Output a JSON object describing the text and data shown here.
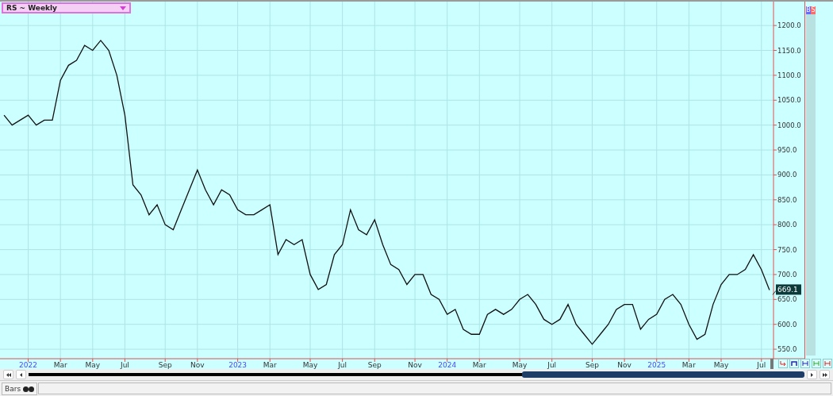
{
  "side_buttons": [
    {
      "label": "B",
      "color": "#6a6aff"
    },
    {
      "label": "S",
      "color": "#ff6a6a"
    }
  ],
  "last_price": "669.1",
  "status_tab": "Bars",
  "chart_data": {
    "type": "line",
    "title": "RS ~ Weekly",
    "grid": true,
    "ylim": [
      531,
      1248
    ],
    "categories": [
      null,
      null,
      null,
      "2022",
      null,
      null,
      null,
      "Mar",
      null,
      null,
      null,
      "May",
      null,
      null,
      null,
      "Jul",
      null,
      null,
      null,
      null,
      "Sep",
      null,
      null,
      null,
      "Nov",
      null,
      null,
      null,
      null,
      "2023",
      null,
      null,
      null,
      "Mar",
      null,
      null,
      null,
      null,
      "May",
      null,
      null,
      null,
      "Jul",
      null,
      null,
      null,
      "Sep",
      null,
      null,
      null,
      null,
      "Nov",
      null,
      null,
      null,
      "2024",
      null,
      null,
      null,
      "Mar",
      null,
      null,
      null,
      null,
      "May",
      null,
      null,
      null,
      "Jul",
      null,
      null,
      null,
      null,
      "Sep",
      null,
      null,
      null,
      "Nov",
      null,
      null,
      null,
      "2025",
      null,
      null,
      null,
      "Mar",
      null,
      null,
      null,
      "May",
      null,
      null,
      null,
      null,
      "Jul",
      null
    ],
    "yticks": [
      {
        "value": 550,
        "label": "550.0"
      },
      {
        "value": 600,
        "label": "600.0"
      },
      {
        "value": 650,
        "label": "650.0"
      },
      {
        "value": 700,
        "label": "700.0"
      },
      {
        "value": 750,
        "label": "750.0"
      },
      {
        "value": 800,
        "label": "800.0"
      },
      {
        "value": 850,
        "label": "850.0"
      },
      {
        "value": 900,
        "label": "900.0"
      },
      {
        "value": 950,
        "label": "950.0"
      },
      {
        "value": 1000,
        "label": "1000.0"
      },
      {
        "value": 1050,
        "label": "1050.0"
      },
      {
        "value": 1100,
        "label": "1100.0"
      },
      {
        "value": 1150,
        "label": "1150.0"
      },
      {
        "value": 1200,
        "label": "1200.0"
      }
    ],
    "series": [
      {
        "color": "#111111",
        "values": [
          1020,
          1000,
          1010,
          1020,
          1000,
          1010,
          1010,
          1090,
          1120,
          1130,
          1160,
          1150,
          1170,
          1150,
          1100,
          1020,
          880,
          860,
          820,
          840,
          800,
          790,
          830,
          870,
          910,
          870,
          840,
          870,
          860,
          830,
          820,
          820,
          830,
          840,
          740,
          770,
          760,
          770,
          700,
          670,
          680,
          740,
          760,
          830,
          790,
          780,
          810,
          760,
          720,
          710,
          680,
          700,
          700,
          660,
          650,
          620,
          630,
          590,
          580,
          580,
          620,
          630,
          620,
          630,
          650,
          660,
          640,
          610,
          600,
          610,
          640,
          600,
          580,
          560,
          580,
          600,
          630,
          640,
          640,
          590,
          610,
          620,
          650,
          660,
          640,
          600,
          570,
          580,
          640,
          680,
          700,
          700,
          710,
          740,
          710,
          669
        ]
      }
    ]
  }
}
